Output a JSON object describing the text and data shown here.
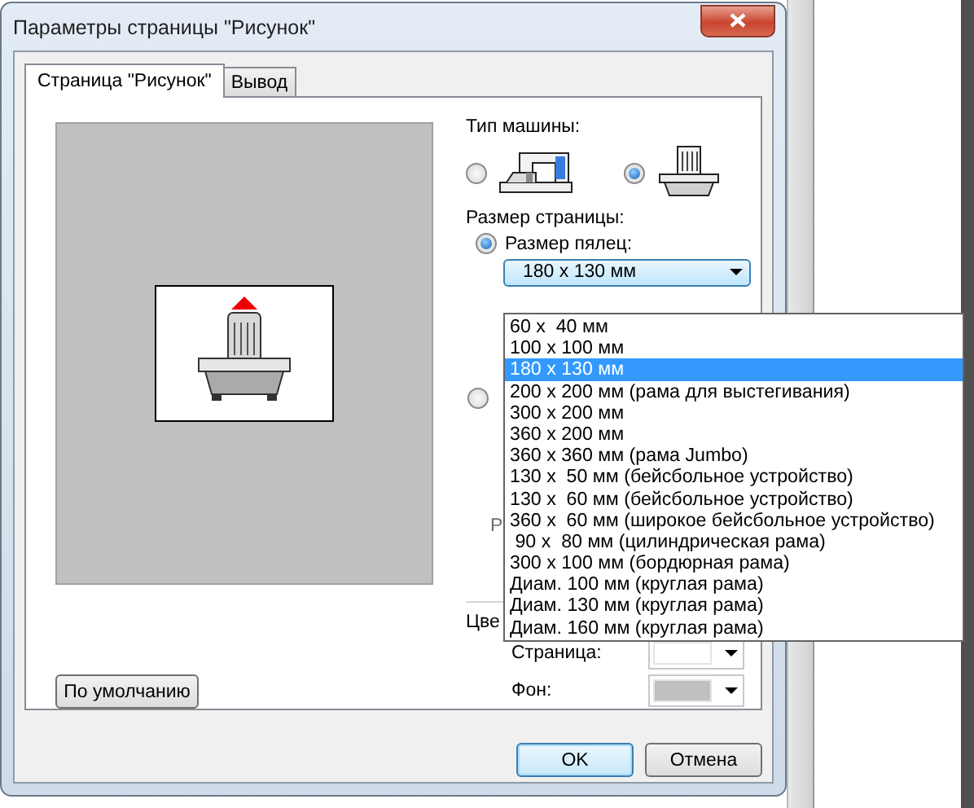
{
  "window": {
    "title": "Параметры страницы \"Рисунок\""
  },
  "tabs": [
    {
      "label": "Страница \"Рисунок\"",
      "selected": true
    },
    {
      "label": "Вывод",
      "selected": false
    }
  ],
  "machine_type": {
    "label": "Тип машины:",
    "options": [
      {
        "kind": "sewing",
        "selected": false
      },
      {
        "kind": "embroidery",
        "selected": true
      }
    ]
  },
  "page_size": {
    "label": "Размер страницы:",
    "hoop_option": {
      "label": "Размер пялец:",
      "selected": true
    },
    "hoop_combo": {
      "value": "180 x 130 мм",
      "items": [
        {
          "label": "60 x  40 мм",
          "selected": false
        },
        {
          "label": "100 x 100 мм",
          "selected": false
        },
        {
          "label": "180 x 130 мм",
          "selected": true
        },
        {
          "label": "200 x 200 мм (рама для выстегивания)",
          "selected": false
        },
        {
          "label": "300 x 200 мм",
          "selected": false
        },
        {
          "label": "360 x 200 мм",
          "selected": false
        },
        {
          "label": "360 x 360 мм (рама Jumbo)",
          "selected": false
        },
        {
          "label": "130 x  50 мм (бейсбольное устройство)",
          "selected": false
        },
        {
          "label": "130 x  60 мм (бейсбольное устройство)",
          "selected": false
        },
        {
          "label": "360 x  60 мм (широкое бейсбольное устройство)",
          "selected": false
        },
        {
          "label": " 90 x  80 мм (цилиндрическая рама)",
          "selected": false
        },
        {
          "label": "300 x 100 мм (бордюрная рама)",
          "selected": false
        },
        {
          "label": "Диам. 100 мм (круглая рама)",
          "selected": false
        },
        {
          "label": "Диам. 130 мм (круглая рама)",
          "selected": false
        },
        {
          "label": "Диам. 160 мм (круглая рама)",
          "selected": false
        }
      ]
    },
    "other_option": {
      "selected": false
    },
    "cut_label": "Р"
  },
  "colors": {
    "label": "Цве",
    "items": [
      {
        "label": "Страница:",
        "color": "#ffffff"
      },
      {
        "label": "Фон:",
        "color": "#c0c0c0"
      }
    ]
  },
  "default_button": "По умолчанию",
  "buttons": [
    "OK",
    "Отмена"
  ]
}
